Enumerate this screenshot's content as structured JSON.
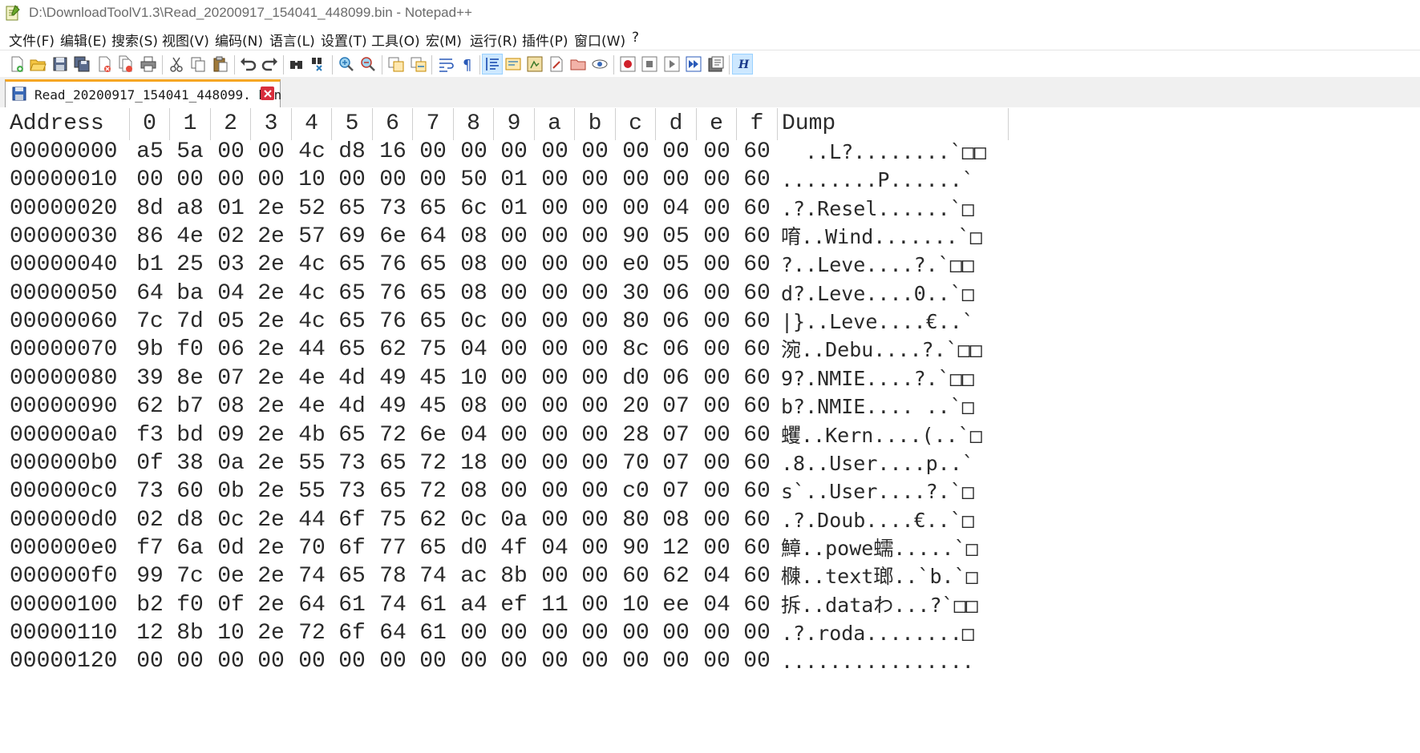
{
  "window": {
    "title": "D:\\DownloadToolV1.3\\Read_20200917_154041_448099.bin - Notepad++"
  },
  "menu": [
    "文件(F)",
    "编辑(E)",
    "搜索(S)",
    "视图(V)",
    "编码(N)",
    "语言(L)",
    "设置(T)",
    "工具(O)",
    "宏(M)",
    "运行(R)",
    "插件(P)",
    "窗口(W)",
    "?"
  ],
  "toolbar": {
    "icons": [
      "new-file-icon",
      "open-file-icon",
      "save-icon",
      "save-all-icon",
      "close-icon",
      "close-all-icon",
      "print-icon",
      "cut-icon",
      "copy-icon",
      "paste-icon",
      "undo-icon",
      "redo-icon",
      "find-icon",
      "replace-icon",
      "zoom-in-icon",
      "zoom-out-icon",
      "sync-vertical-icon",
      "sync-horizontal-icon",
      "word-wrap-icon",
      "show-all-chars-icon",
      "indent-guide-icon",
      "doc-map-icon",
      "function-list-icon",
      "folder-workspace-icon",
      "monitor-icon",
      "folder-icon",
      "eye-icon",
      "record-macro-icon",
      "stop-macro-icon",
      "play-macro-icon",
      "run-macro-multiple-icon",
      "save-macro-icon",
      "hex-editor-icon"
    ],
    "active_icons": [
      "indent-guide-icon",
      "hex-editor-icon"
    ]
  },
  "tab": {
    "label": "Read_20200917_154041_448099. bin"
  },
  "hex": {
    "header": {
      "address": "Address",
      "columns": [
        "0",
        "1",
        "2",
        "3",
        "4",
        "5",
        "6",
        "7",
        "8",
        "9",
        "a",
        "b",
        "c",
        "d",
        "e",
        "f"
      ],
      "dump": "Dump"
    },
    "rows": [
      {
        "addr": "00000000",
        "bytes": [
          "a5",
          "5a",
          "00",
          "00",
          "4c",
          "d8",
          "16",
          "00",
          "00",
          "00",
          "00",
          "00",
          "00",
          "00",
          "00",
          "60"
        ],
        "dump": "  ..L?........`□□"
      },
      {
        "addr": "00000010",
        "bytes": [
          "00",
          "00",
          "00",
          "00",
          "10",
          "00",
          "00",
          "00",
          "50",
          "01",
          "00",
          "00",
          "00",
          "00",
          "00",
          "60"
        ],
        "dump": "........P......`"
      },
      {
        "addr": "00000020",
        "bytes": [
          "8d",
          "a8",
          "01",
          "2e",
          "52",
          "65",
          "73",
          "65",
          "6c",
          "01",
          "00",
          "00",
          "00",
          "04",
          "00",
          "60"
        ],
        "dump": ".?.Resel......`□"
      },
      {
        "addr": "00000030",
        "bytes": [
          "86",
          "4e",
          "02",
          "2e",
          "57",
          "69",
          "6e",
          "64",
          "08",
          "00",
          "00",
          "00",
          "90",
          "05",
          "00",
          "60"
        ],
        "dump": "唷..Wind.......`□"
      },
      {
        "addr": "00000040",
        "bytes": [
          "b1",
          "25",
          "03",
          "2e",
          "4c",
          "65",
          "76",
          "65",
          "08",
          "00",
          "00",
          "00",
          "e0",
          "05",
          "00",
          "60"
        ],
        "dump": "?..Leve....?.`□□"
      },
      {
        "addr": "00000050",
        "bytes": [
          "64",
          "ba",
          "04",
          "2e",
          "4c",
          "65",
          "76",
          "65",
          "08",
          "00",
          "00",
          "00",
          "30",
          "06",
          "00",
          "60"
        ],
        "dump": "d?.Leve....0..`□"
      },
      {
        "addr": "00000060",
        "bytes": [
          "7c",
          "7d",
          "05",
          "2e",
          "4c",
          "65",
          "76",
          "65",
          "0c",
          "00",
          "00",
          "00",
          "80",
          "06",
          "00",
          "60"
        ],
        "dump": "|}..Leve....€..`"
      },
      {
        "addr": "00000070",
        "bytes": [
          "9b",
          "f0",
          "06",
          "2e",
          "44",
          "65",
          "62",
          "75",
          "04",
          "00",
          "00",
          "00",
          "8c",
          "06",
          "00",
          "60"
        ],
        "dump": "涴..Debu....?.`□□"
      },
      {
        "addr": "00000080",
        "bytes": [
          "39",
          "8e",
          "07",
          "2e",
          "4e",
          "4d",
          "49",
          "45",
          "10",
          "00",
          "00",
          "00",
          "d0",
          "06",
          "00",
          "60"
        ],
        "dump": "9?.NMIE....?.`□□"
      },
      {
        "addr": "00000090",
        "bytes": [
          "62",
          "b7",
          "08",
          "2e",
          "4e",
          "4d",
          "49",
          "45",
          "08",
          "00",
          "00",
          "00",
          "20",
          "07",
          "00",
          "60"
        ],
        "dump": "b?.NMIE.... ..`□"
      },
      {
        "addr": "000000a0",
        "bytes": [
          "f3",
          "bd",
          "09",
          "2e",
          "4b",
          "65",
          "72",
          "6e",
          "04",
          "00",
          "00",
          "00",
          "28",
          "07",
          "00",
          "60"
        ],
        "dump": "蠼..Kern....(..`□"
      },
      {
        "addr": "000000b0",
        "bytes": [
          "0f",
          "38",
          "0a",
          "2e",
          "55",
          "73",
          "65",
          "72",
          "18",
          "00",
          "00",
          "00",
          "70",
          "07",
          "00",
          "60"
        ],
        "dump": ".8..User....p..`"
      },
      {
        "addr": "000000c0",
        "bytes": [
          "73",
          "60",
          "0b",
          "2e",
          "55",
          "73",
          "65",
          "72",
          "08",
          "00",
          "00",
          "00",
          "c0",
          "07",
          "00",
          "60"
        ],
        "dump": "s`..User....?.`□"
      },
      {
        "addr": "000000d0",
        "bytes": [
          "02",
          "d8",
          "0c",
          "2e",
          "44",
          "6f",
          "75",
          "62",
          "0c",
          "0a",
          "00",
          "00",
          "80",
          "08",
          "00",
          "60"
        ],
        "dump": ".?.Doub....€..`□"
      },
      {
        "addr": "000000e0",
        "bytes": [
          "f7",
          "6a",
          "0d",
          "2e",
          "70",
          "6f",
          "77",
          "65",
          "d0",
          "4f",
          "04",
          "00",
          "90",
          "12",
          "00",
          "60"
        ],
        "dump": "鱆..powe蠕.....`□"
      },
      {
        "addr": "000000f0",
        "bytes": [
          "99",
          "7c",
          "0e",
          "2e",
          "74",
          "65",
          "78",
          "74",
          "ac",
          "8b",
          "00",
          "00",
          "60",
          "62",
          "04",
          "60"
        ],
        "dump": "樄..text瑯..`b.`□"
      },
      {
        "addr": "00000100",
        "bytes": [
          "b2",
          "f0",
          "0f",
          "2e",
          "64",
          "61",
          "74",
          "61",
          "a4",
          "ef",
          "11",
          "00",
          "10",
          "ee",
          "04",
          "60"
        ],
        "dump": "拆..dataわ...?`□□"
      },
      {
        "addr": "00000110",
        "bytes": [
          "12",
          "8b",
          "10",
          "2e",
          "72",
          "6f",
          "64",
          "61",
          "00",
          "00",
          "00",
          "00",
          "00",
          "00",
          "00",
          "00"
        ],
        "dump": ".?.roda........□"
      },
      {
        "addr": "00000120",
        "bytes": [
          "00",
          "00",
          "00",
          "00",
          "00",
          "00",
          "00",
          "00",
          "00",
          "00",
          "00",
          "00",
          "00",
          "00",
          "00",
          "00"
        ],
        "dump": "................"
      }
    ]
  }
}
